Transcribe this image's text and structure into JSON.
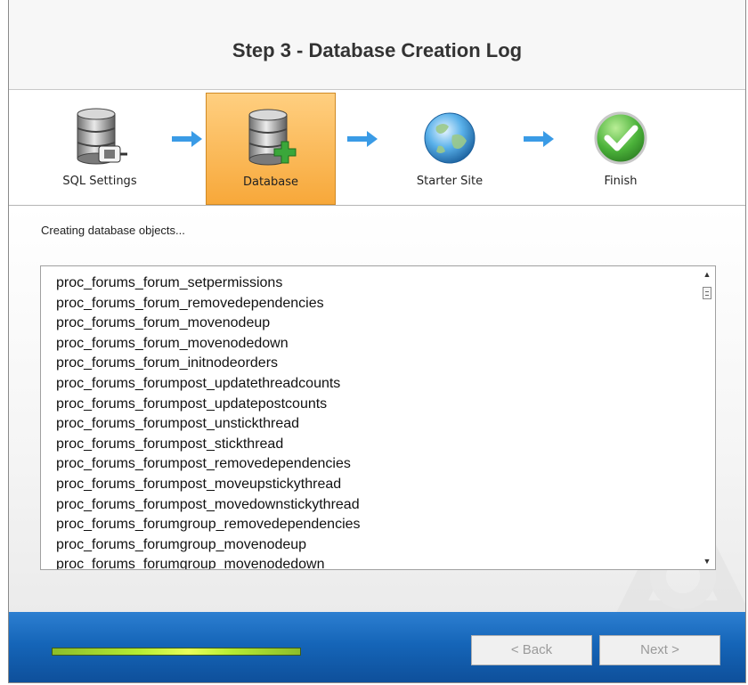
{
  "header": {
    "title": "Step 3 - Database Creation Log"
  },
  "steps": [
    {
      "label": "SQL Settings",
      "icon": "database-connect-icon",
      "active": false
    },
    {
      "label": "Database",
      "icon": "database-add-icon",
      "active": true
    },
    {
      "label": "Starter Site",
      "icon": "globe-icon",
      "active": false
    },
    {
      "label": "Finish",
      "icon": "checkmark-icon",
      "active": false
    }
  ],
  "content": {
    "status_text": "Creating database objects...",
    "log_lines": [
      "proc_forums_forum_setpermissions",
      "proc_forums_forum_removedependencies",
      "proc_forums_forum_movenodeup",
      "proc_forums_forum_movenodedown",
      "proc_forums_forum_initnodeorders",
      "proc_forums_forumpost_updatethreadcounts",
      "proc_forums_forumpost_updatepostcounts",
      "proc_forums_forumpost_unstickthread",
      "proc_forums_forumpost_stickthread",
      "proc_forums_forumpost_removedependencies",
      "proc_forums_forumpost_moveupstickythread",
      "proc_forums_forumpost_movedownstickythread",
      "proc_forums_forumgroup_removedependencies",
      "proc_forums_forumgroup_movenodeup",
      "proc_forums_forumgroup_movenodedown"
    ]
  },
  "footer": {
    "progress_fraction": 1.0,
    "back_label": "< Back",
    "next_label": "Next >"
  },
  "colors": {
    "active_step": "#f7a83a",
    "footer_blue": "#1565b8",
    "progress_green": "#b6ec33"
  }
}
